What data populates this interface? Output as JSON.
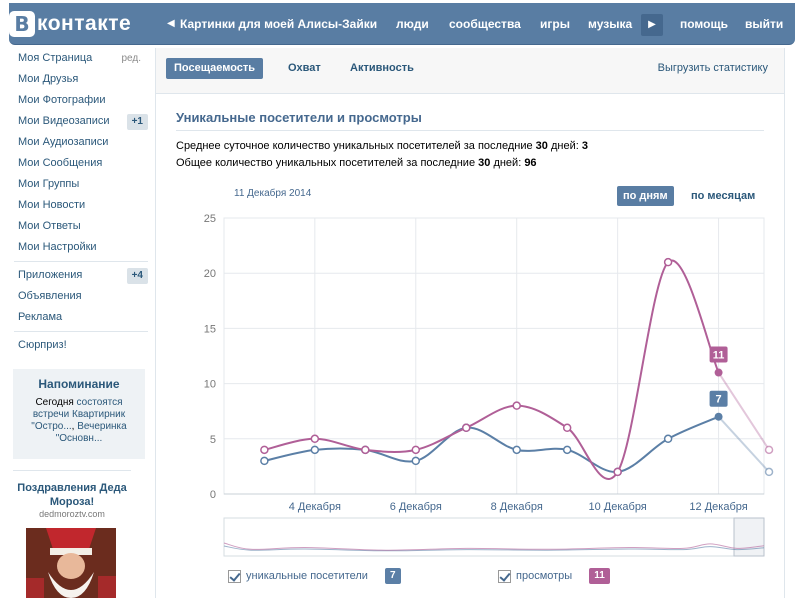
{
  "header": {
    "logo_letter": "В",
    "logo_text": "контакте",
    "current_app": "Картинки для моей Алисы-Зайки",
    "nav": [
      "люди",
      "сообщества",
      "игры",
      "музыка",
      "помощь",
      "выйти"
    ]
  },
  "sidebar": {
    "edit_label": "ред.",
    "items": [
      {
        "label": "Моя Страница"
      },
      {
        "label": "Мои Друзья"
      },
      {
        "label": "Мои Фотографии"
      },
      {
        "label": "Мои Видеозаписи",
        "badge": "+1"
      },
      {
        "label": "Мои Аудиозаписи"
      },
      {
        "label": "Мои Сообщения"
      },
      {
        "label": "Мои Группы"
      },
      {
        "label": "Мои Новости"
      },
      {
        "label": "Мои Ответы"
      },
      {
        "label": "Мои Настройки"
      }
    ],
    "items2": [
      {
        "label": "Приложения",
        "badge": "+4"
      },
      {
        "label": "Объявления"
      },
      {
        "label": "Реклама"
      }
    ],
    "surprise": "Сюрприз!",
    "reminder": {
      "title": "Напоминание",
      "today": "Сегодня",
      "meetings": "состоятся встречи",
      "event1": "Квартирник \"Остро...",
      "event2": "Вечеринка \"Основн..."
    },
    "ad": {
      "title": "Поздравления Деда Мороза!",
      "site": "dedmoroztv.com"
    }
  },
  "main": {
    "tabs": [
      "Посещаемость",
      "Охват",
      "Активность"
    ],
    "export_label": "Выгрузить статистику",
    "section_title": "Уникальные посетители и просмотры",
    "avg_line": {
      "prefix": "Среднее суточное количество уникальных посетителей за последние",
      "days": "30",
      "suffix": "дней:",
      "value": "3"
    },
    "total_line": {
      "prefix": "Общее количество уникальных посетителей за последние",
      "days": "30",
      "suffix": "дней:",
      "value": "96"
    },
    "date_label": "11 Декабря 2014",
    "period_buttons": [
      "по дням",
      "по месяцам"
    ]
  },
  "chart_data": {
    "type": "line",
    "yticks": [
      0,
      5,
      10,
      15,
      20,
      25
    ],
    "ylim": [
      0,
      25
    ],
    "xtick_labels": [
      "4 Декабря",
      "6 Декабря",
      "8 Декабря",
      "10 Декабря",
      "12 Декабря"
    ],
    "xtick_days": [
      4,
      6,
      8,
      10,
      12
    ],
    "xlim_days": [
      2.2,
      12.9
    ],
    "x_days": [
      3,
      4,
      5,
      6,
      7,
      8,
      9,
      10,
      11,
      12,
      13
    ],
    "series": [
      {
        "name": "уникальные посетители",
        "color": "#5b7fa6",
        "values": [
          3,
          4,
          4,
          3,
          6,
          4,
          4,
          2,
          5,
          7,
          2
        ],
        "highlight_value": "7"
      },
      {
        "name": "просмотры",
        "color": "#b05f97",
        "values": [
          4,
          5,
          4,
          4,
          6,
          8,
          6,
          2,
          21,
          11,
          4
        ],
        "highlight_value": "11"
      }
    ],
    "grid": true
  },
  "legend": [
    {
      "label": "уникальные посетители",
      "badge": "7",
      "color": "#5b7fa6"
    },
    {
      "label": "просмотры",
      "badge": "11",
      "color": "#b05f97"
    }
  ]
}
